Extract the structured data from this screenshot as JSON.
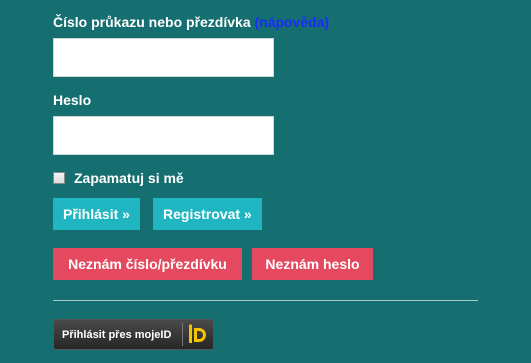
{
  "login": {
    "card_label": "Číslo průkazu nebo přezdívka",
    "help_link": "(nápověda)",
    "card_value": "",
    "password_label": "Heslo",
    "password_value": "",
    "remember_label": "Zapamatuj si mě",
    "remember_checked": false
  },
  "buttons": {
    "login": "Přihlásit »",
    "register": "Registrovat »",
    "forgot_card": "Neznám číslo/přezdívku",
    "forgot_password": "Neznám heslo",
    "mojeid": "Přihlásit přes mojeID"
  },
  "colors": {
    "background": "#156e6f",
    "accent_teal": "#1fb6c1",
    "accent_red": "#e5495f",
    "link_blue": "#1a2bff",
    "mojeid_yellow": "#f5c400"
  },
  "icons": {
    "mojeid": "mojeid-logo-icon"
  }
}
